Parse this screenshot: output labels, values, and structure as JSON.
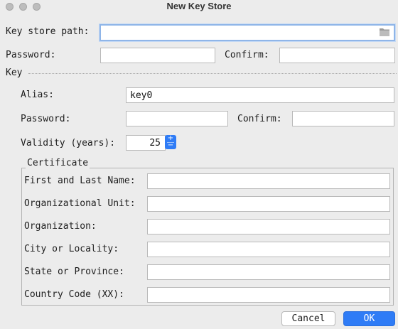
{
  "window": {
    "title": "New Key Store"
  },
  "keystore": {
    "path_label": "Key store path:",
    "path_value": "",
    "password_label": "Password:",
    "password_value": "",
    "confirm_label": "Confirm:",
    "confirm_value": ""
  },
  "key": {
    "section_label": "Key",
    "alias_label": "Alias:",
    "alias_value": "key0",
    "password_label": "Password:",
    "password_value": "",
    "confirm_label": "Confirm:",
    "confirm_value": "",
    "validity_label": "Validity (years):",
    "validity_value": "25",
    "spinner_up": "+",
    "spinner_down": "−"
  },
  "certificate": {
    "section_label": "Certificate",
    "first_last_name_label": "First and Last Name:",
    "org_unit_label": "Organizational Unit:",
    "organization_label": "Organization:",
    "city_label": "City or Locality:",
    "state_label": "State or Province:",
    "country_code_label": "Country Code (XX):"
  },
  "buttons": {
    "cancel": "Cancel",
    "ok": "OK"
  },
  "icons": {
    "browse": "folder-icon"
  },
  "colors": {
    "accent": "#2f7cf6",
    "focus_ring": "#8fb5e8"
  }
}
